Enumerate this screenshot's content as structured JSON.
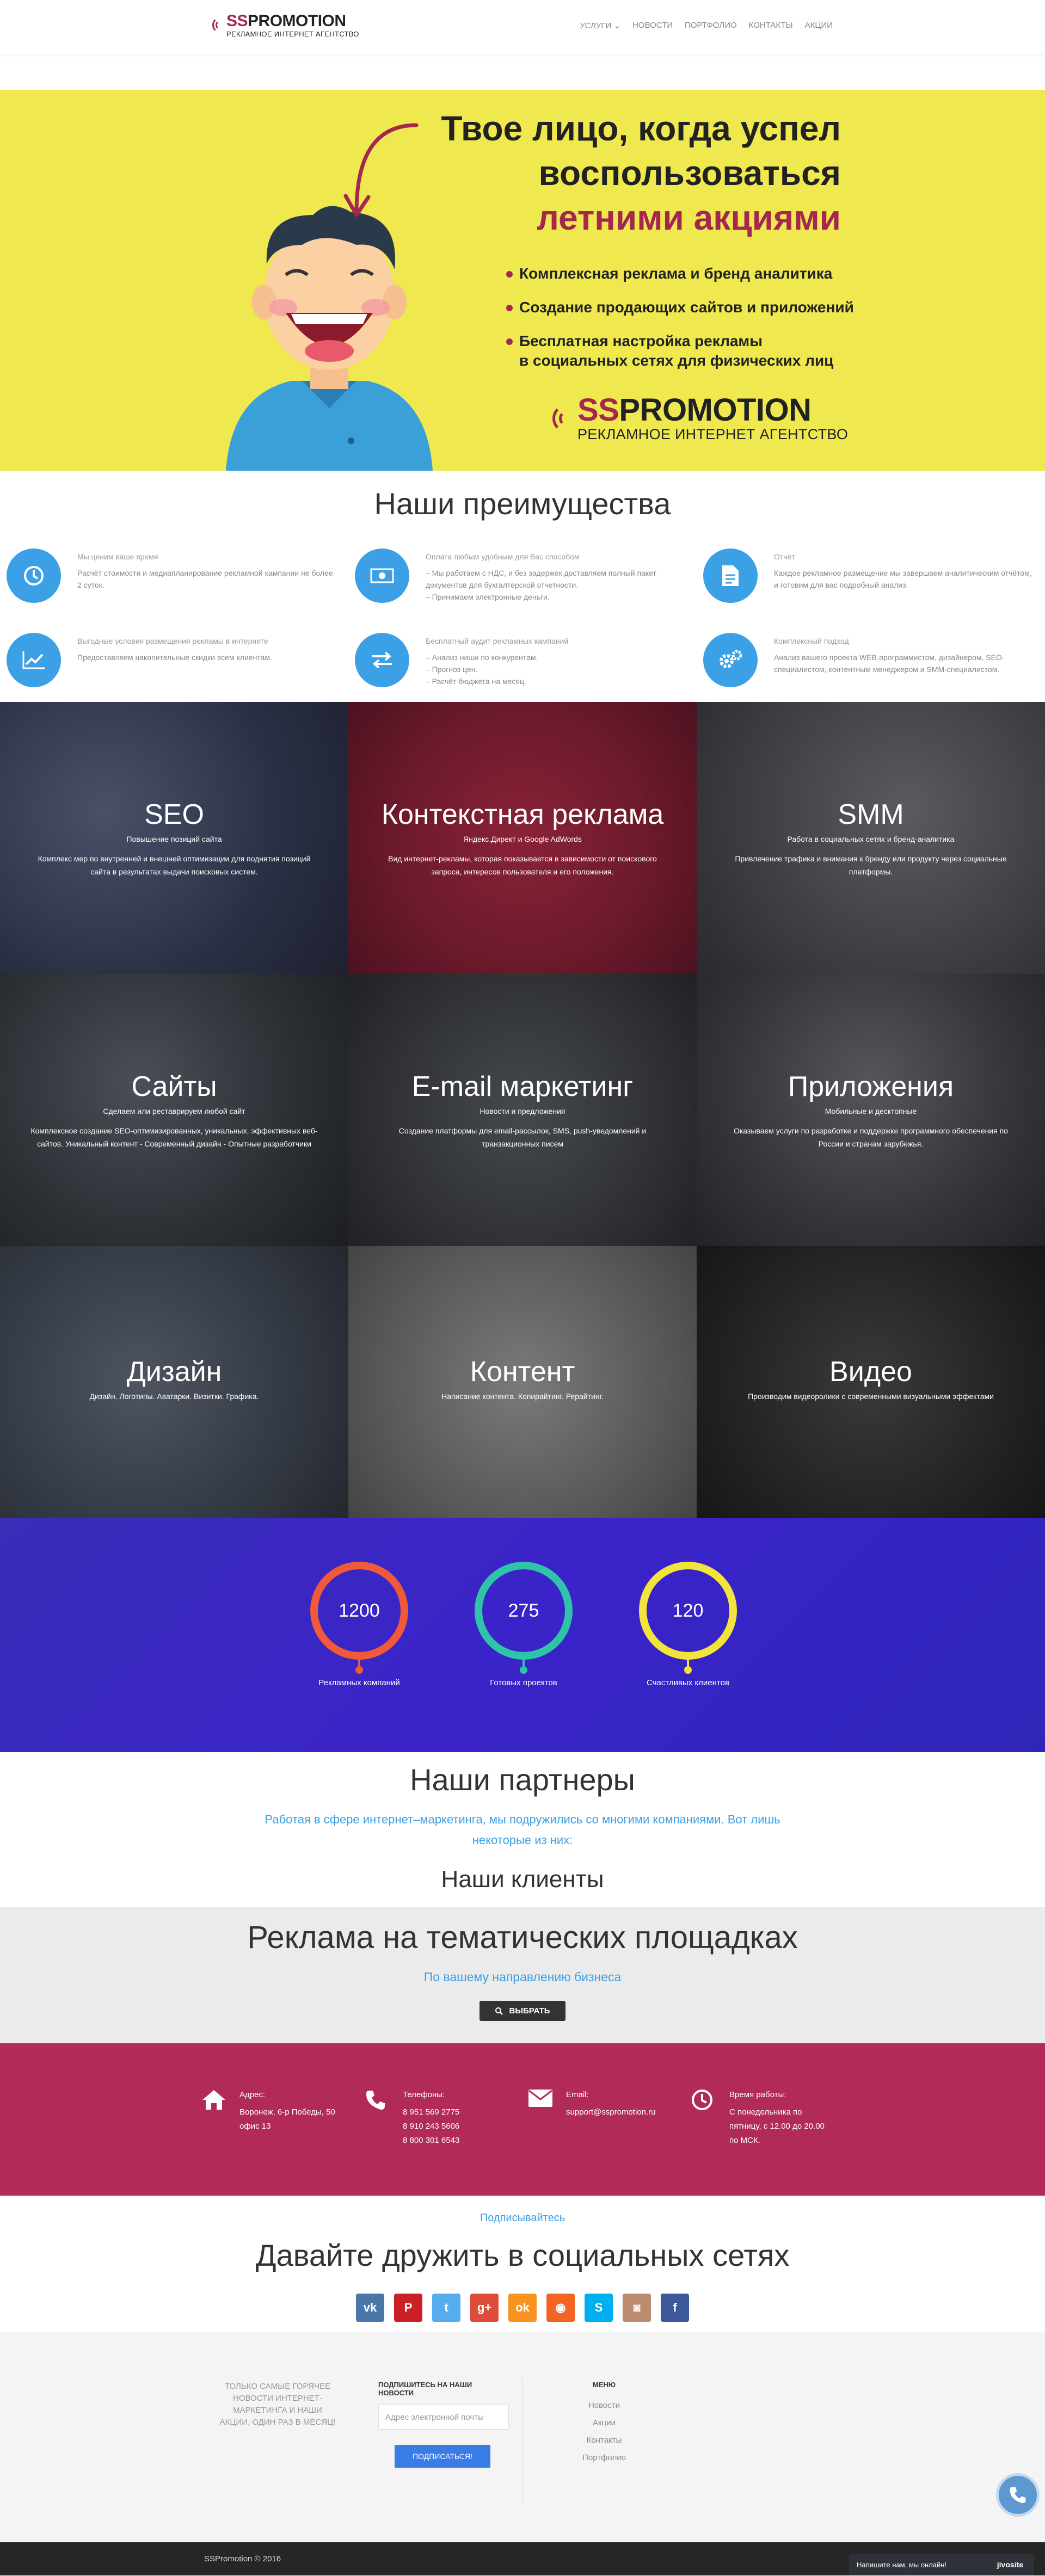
{
  "header": {
    "logo_main_pre": "SS",
    "logo_main_post": "PROMOTION",
    "logo_sub": "РЕКЛАМНОЕ ИНТЕРНЕТ АГЕНТСТВО",
    "nav": [
      "Услуги",
      "Новости",
      "Портфолио",
      "Контакты",
      "Акции"
    ]
  },
  "hero": {
    "line1": "Твое лицо, когда успел",
    "line2": "воспользоваться",
    "line3": "летними акциями",
    "bullets": [
      "Комплексная реклама и бренд аналитика",
      "Создание продающих сайтов и приложений",
      "Бесплатная настройка рекламы"
    ],
    "bullet3_line2": "в социальных сетях для физических лиц",
    "logo_main_pre": "SS",
    "logo_main_post": "PROMOTION",
    "logo_sub": "РЕКЛАМНОЕ ИНТЕРНЕТ АГЕНТСТВО"
  },
  "advantages": {
    "title": "Наши преимущества",
    "items": [
      {
        "icon": "clock-icon",
        "title": "Мы ценим ваше время",
        "text": "Расчёт стоимости и медиапланирование рекламной кампании не более 2 суток."
      },
      {
        "icon": "money-icon",
        "title": "Оплата любым удобным для Вас способом",
        "text": "– Мы работаем с НДС, и без задержек доставляем полный пакет документов для бухгалтерской отчетности.\n– Принимаем электронные деньги."
      },
      {
        "icon": "document-icon",
        "title": "Отчёт",
        "text": "Каждое рекламное размещение мы завершаем аналитическим отчётом, и готовим для вас подробный анализ."
      },
      {
        "icon": "chart-icon",
        "title": "Выгодные условия размещения рекламы в интернете",
        "text": "Предоставляем накопительные скидки всем клиентам."
      },
      {
        "icon": "exchange-icon",
        "title": "Бесплатный аудит рекламных кампаний",
        "text": "– Анализ ниши по конкурентам.\n– Прогноз цен.\n– Расчёт бюджета на месяц."
      },
      {
        "icon": "gears-icon",
        "title": "Комплексный подход",
        "text": "Анализ вашего проекта WEB-программистом, дизайнером, SEO-специалистом, контентным менеджером и SMM-специалистом."
      }
    ]
  },
  "services": [
    {
      "title": "SEO",
      "sub": "Повышение позиций сайта",
      "desc": "Комплекс мер по внутренней и внешней оптимизации для поднятия позиций сайта в результатах выдачи поисковых систем.",
      "bg": "#2a3044"
    },
    {
      "title": "Контекстная реклама",
      "sub": "Яндекс.Директ и Google AdWords",
      "desc": "Вид интернет-рекламы, которая показывается в зависимости от поискового запроса, интересов пользователя и его поло­жения.",
      "bg": "#6d1a2c"
    },
    {
      "title": "SMM",
      "sub": "Работа в социальных сетях и бренд-аналитика",
      "desc": "Привлечение трафика и внимания к бренду или продукту через социальные платформы.",
      "bg": "#3f3f44"
    },
    {
      "title": "Сайты",
      "sub": "Сделаем или реставрируем любой сайт",
      "desc": "Комплексное создание SEO-оптимизированных, уникальных, эффективных веб-сайтов. Уникальный контент - Современный дизайн - Опытные разработчики",
      "bg": "#2b2e33"
    },
    {
      "title": "E-mail маркетинг",
      "sub": "Новости и предложения",
      "desc": "Создание платформы для email-рассылок, SMS, push-уведомлений и транзакционных писем",
      "bg": "#303236"
    },
    {
      "title": "Приложения",
      "sub": "Мобильные и десктопные",
      "desc": "Оказываем услуги по разработке и поддержке программного обеспечения по России и странам зарубежья.",
      "bg": "#34353a"
    },
    {
      "title": "Дизайн",
      "sub": "Дизайн. Логотипы. Аватарки. Визитки. Графика.",
      "desc": "",
      "bg": "#343a44"
    },
    {
      "title": "Контент",
      "sub": "Написание контента. Копирайтинг. Рерайтинг.",
      "desc": "",
      "bg": "#5a5a5a"
    },
    {
      "title": "Видео",
      "sub": "Производим видеоролики с современными визуальными эффектами",
      "desc": "",
      "bg": "#242424"
    }
  ],
  "counters": [
    {
      "value": "1200",
      "label": "Рекламных компаний",
      "color": "#f05a3a"
    },
    {
      "value": "275",
      "label": "Готовых проектов",
      "color": "#2fc4a8"
    },
    {
      "value": "120",
      "label": "Счастливых клиентов",
      "color": "#f3e43b"
    }
  ],
  "partners": {
    "title": "Наши партнеры",
    "lead": "Работая в сфере интернет–маркетинга, мы подружились со многими компаниями. Вот лишь некоторые из них:",
    "clients_title": "Наши клиенты"
  },
  "thematic": {
    "title": "Реклама на тематических площадках",
    "lead": "По вашему направлению бизнеса",
    "button": "ВЫБРАТЬ"
  },
  "contacts": [
    {
      "icon": "home-icon",
      "label": "Адрес:",
      "lines": [
        "Воронеж, 6-р Победы, 50",
        "офис 13"
      ]
    },
    {
      "icon": "phone-icon",
      "label": "Телефоны:",
      "lines": [
        "8 951 569 2775",
        "8 910 243 5606",
        "8 800 301 6543"
      ]
    },
    {
      "icon": "mail-icon",
      "label": "Email:",
      "lines": [
        "support@sspromotion.ru"
      ]
    },
    {
      "icon": "clock-icon",
      "label": "Время работы:",
      "lines": [
        "С понедельника по",
        "пятницу, с 12.00 до 20.00",
        "по МСК."
      ]
    }
  ],
  "subscribe": {
    "link": "Подписывайтесь",
    "title": "Давайте дружить в социальных сетях",
    "socials": [
      {
        "name": "vk-icon",
        "glyph": "vk",
        "color": "#4a76a8"
      },
      {
        "name": "pinterest-icon",
        "glyph": "P",
        "color": "#cb2027"
      },
      {
        "name": "twitter-icon",
        "glyph": "t",
        "color": "#55acee"
      },
      {
        "name": "google-plus-icon",
        "glyph": "g+",
        "color": "#dd4b39"
      },
      {
        "name": "odnoklassniki-icon",
        "glyph": "ok",
        "color": "#f7931e"
      },
      {
        "name": "rss-icon",
        "glyph": "◉",
        "color": "#f26522"
      },
      {
        "name": "skype-icon",
        "glyph": "S",
        "color": "#00aff0"
      },
      {
        "name": "instagram-icon",
        "glyph": "◙",
        "color": "#bc8a6e"
      },
      {
        "name": "facebook-icon",
        "glyph": "f",
        "color": "#3b5998"
      }
    ]
  },
  "footer": {
    "tagline": "ТОЛЬКО САМЫЕ ГОРЯЧЕЕ НОВОСТИ ИНТЕРНЕТ-МАРКЕТИНГА И НАШИ АКЦИИ, ОДИН РАЗ В МЕСЯЦ!",
    "news_title": "ПОДПИШИТЕСЬ НА НАШИ НОВОСТИ",
    "email_placeholder": "Адрес электронной почты",
    "subscribe_button": "ПОДПИСАТЬСЯ!",
    "menu_title": "МЕНЮ",
    "menu": [
      "Новости",
      "Акции",
      "Контакты",
      "Портфолио"
    ],
    "copyright": "SSPromotion © 2016",
    "chat_text": "Напишите нам, мы онлайн!",
    "chat_brand": "jivosite"
  }
}
